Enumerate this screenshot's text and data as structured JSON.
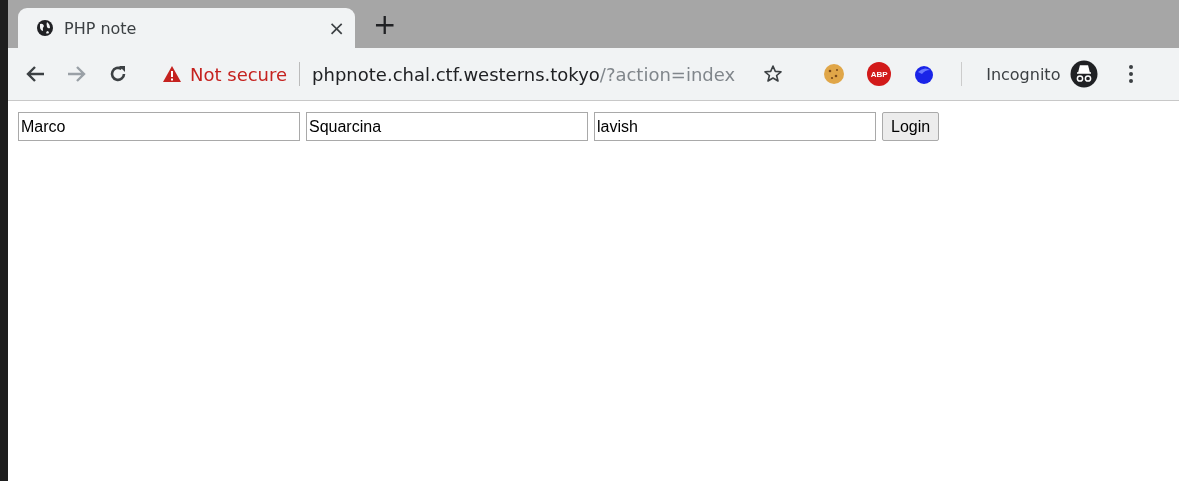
{
  "tab": {
    "title": "PHP note",
    "close": "×",
    "new_tab": "+"
  },
  "toolbar": {
    "security": "Not secure",
    "url_host": "phpnote.chal.ctf.westerns.tokyo",
    "url_path": "/?action=index",
    "extensions": [
      {
        "kind": "cookie"
      },
      {
        "kind": "abp",
        "text": "ABP"
      },
      {
        "kind": "blue"
      }
    ],
    "profile": "Incognito"
  },
  "form": {
    "fields": [
      {
        "value": "Marco"
      },
      {
        "value": "Squarcina"
      },
      {
        "value": "lavish"
      }
    ],
    "button": "Login"
  }
}
